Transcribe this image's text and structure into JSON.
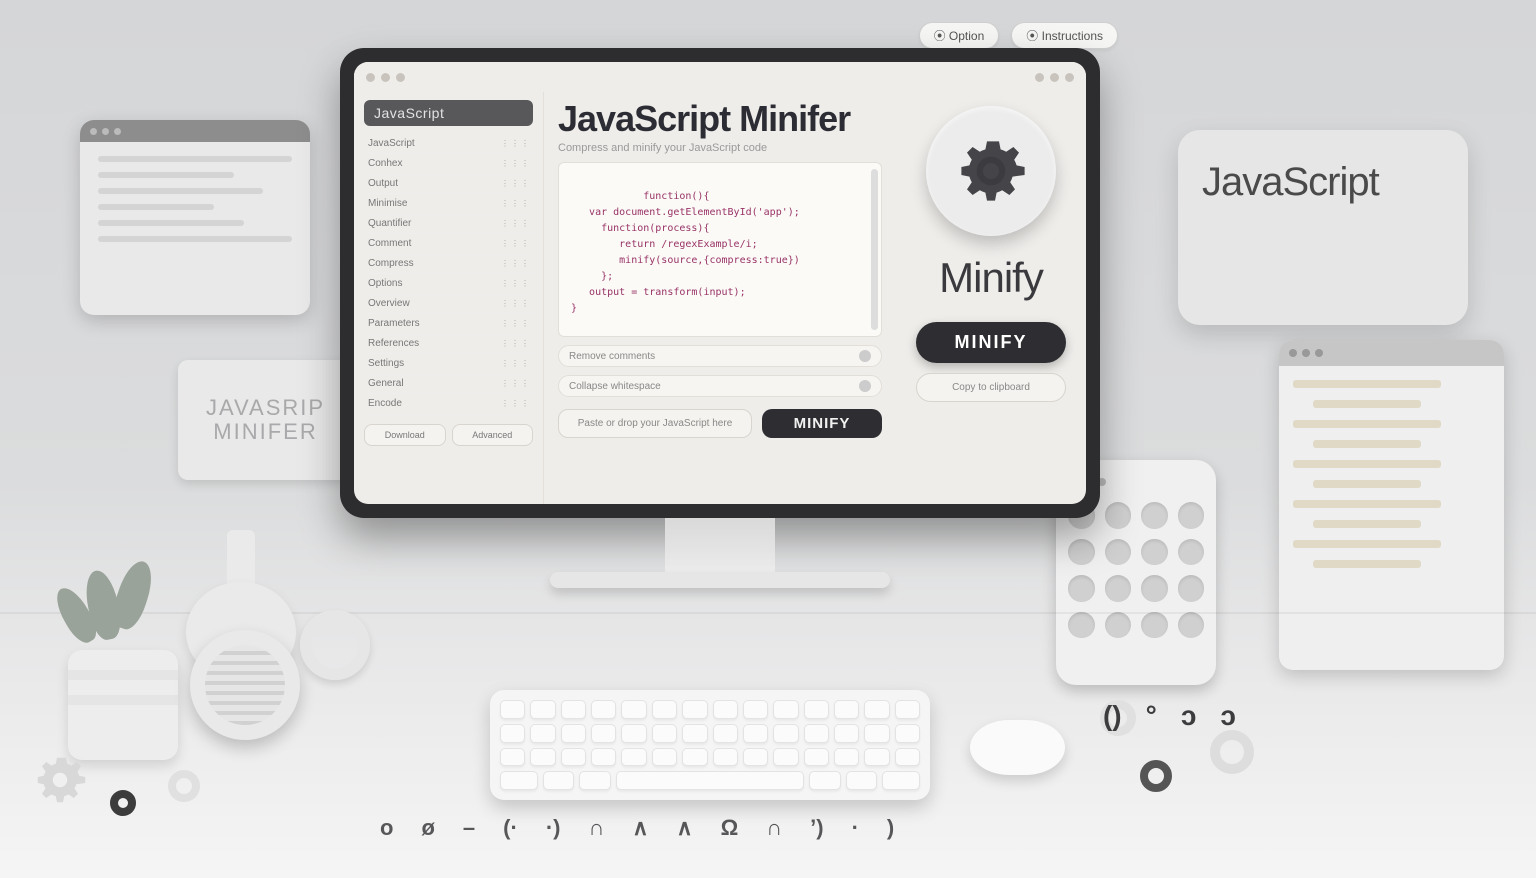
{
  "top_pills": {
    "a": "⦿  Option",
    "b": "⦿  Instructions"
  },
  "header": {
    "title": "JavaScript Minifer",
    "subtitle": "Compress and minify your JavaScript code"
  },
  "sidebar": {
    "header": "JavaScript",
    "items": [
      {
        "label": "JavaScript"
      },
      {
        "label": "Conhex"
      },
      {
        "label": "Output"
      },
      {
        "label": "Minimise"
      },
      {
        "label": "Quantifier"
      },
      {
        "label": "Comment"
      },
      {
        "label": "Compress"
      },
      {
        "label": "Options"
      },
      {
        "label": "Overview"
      },
      {
        "label": "Parameters"
      },
      {
        "label": "References"
      },
      {
        "label": "Settings"
      },
      {
        "label": "General"
      },
      {
        "label": "Encode"
      }
    ],
    "b1": "Download",
    "b2": "Advanced"
  },
  "code_sample": "function(){\\n   var document.getElementById('app');\\n     function(process){\\n        return /regexExample/i;\\n        minify(source,{compress:true})\\n     };\\n   output = transform(input);\\n}",
  "options": {
    "o1": "Remove comments",
    "o2": "Collapse whitespace"
  },
  "actions": {
    "light": "Paste or drop your JavaScript here",
    "dark": "MINIFY"
  },
  "rcol": {
    "big": "Minify",
    "pill": "MINIFY",
    "sec": "Copy to clipboard"
  },
  "cards": {
    "js": "JavaScript",
    "sign1": "JAVASRIP",
    "sign2": "MINIFER"
  },
  "glyphs": [
    "o",
    "ø",
    "–",
    "(·",
    "·)",
    "∩",
    "∧",
    "∧",
    "Ω",
    "∩",
    "’)",
    "·",
    ")"
  ],
  "glyphs2": [
    "()",
    "°",
    "ɔ",
    "ɔ"
  ]
}
